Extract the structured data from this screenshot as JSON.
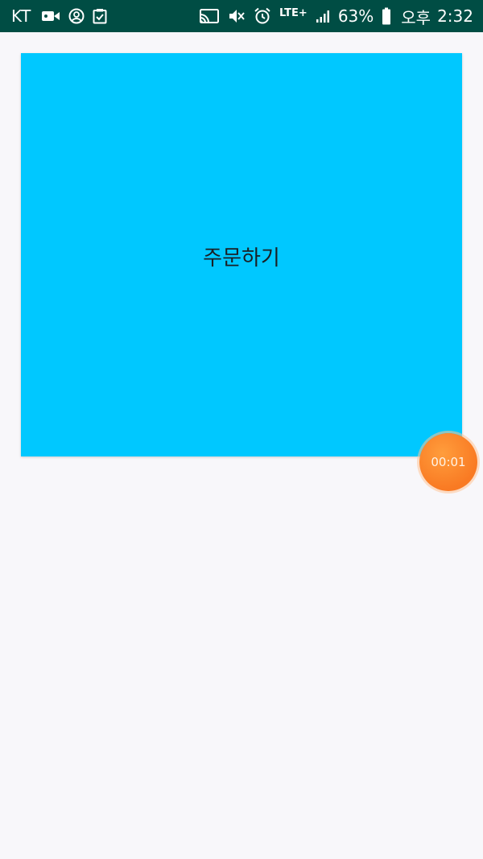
{
  "status_bar": {
    "carrier": "KT",
    "left_icons": [
      "video-camera-icon",
      "account-circle-icon",
      "task-check-icon"
    ],
    "right_icons": [
      "cast-icon",
      "vibrate-mute-icon",
      "alarm-clock-icon",
      "lte-icon",
      "signal-icon",
      "battery-icon"
    ],
    "network": "LTE+",
    "battery": "63%",
    "ampm": "오후",
    "time": "2:32",
    "background": "#004d44"
  },
  "main": {
    "order_button_label": "주문하기",
    "order_button_color": "#00c8ff"
  },
  "timer": {
    "value": "00:01",
    "color": "#f97a23"
  }
}
